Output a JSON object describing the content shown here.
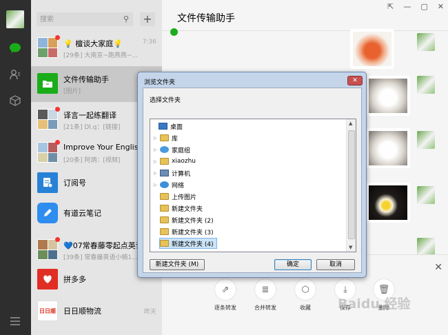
{
  "search": {
    "placeholder": "搜索"
  },
  "chats": [
    {
      "name": "💡 檀谈大家庭💡",
      "preview": "[29条] 大南京~跑燕燕~...",
      "time": "7:36"
    },
    {
      "name": "文件传输助手",
      "preview": "[图片]",
      "time": ""
    },
    {
      "name": "译言一起练翻译",
      "preview": "[21条] Dl.q：[链接]",
      "time": ""
    },
    {
      "name": "Improve Your English",
      "preview": "[20条] 阿炳：[视频]",
      "time": ""
    },
    {
      "name": "订阅号",
      "preview": "",
      "time": ""
    },
    {
      "name": "有道云笔记",
      "preview": "",
      "time": ""
    },
    {
      "name": "💙07常春藤零起点英语",
      "preview": "[39条] 常春藤英语小楠1...",
      "time": ""
    },
    {
      "name": "拼多多",
      "preview": "",
      "time": ""
    },
    {
      "name": "日日顺物流",
      "preview": "",
      "time": "昨天"
    }
  ],
  "main": {
    "title": "文件传输助手"
  },
  "window_controls": {
    "pin": "⇱",
    "min": "—",
    "max": "▢",
    "close": "✕"
  },
  "actions": [
    {
      "label": "逐条转发",
      "icon": "share-icon"
    },
    {
      "label": "合并转发",
      "icon": "merge-icon"
    },
    {
      "label": "收藏",
      "icon": "box-icon"
    },
    {
      "label": "保存",
      "icon": "download-icon"
    },
    {
      "label": "删除",
      "icon": "trash-icon"
    }
  ],
  "dialog": {
    "title": "浏览文件夹",
    "prompt": "选择文件夹",
    "tree": [
      {
        "label": "桌面",
        "level": 0,
        "expander": false
      },
      {
        "label": "库",
        "level": 1,
        "expander": true
      },
      {
        "label": "家庭组",
        "level": 1,
        "expander": true
      },
      {
        "label": "xiaozhu",
        "level": 1,
        "expander": true
      },
      {
        "label": "计算机",
        "level": 1,
        "expander": true
      },
      {
        "label": "网络",
        "level": 1,
        "expander": true
      },
      {
        "label": "上传图片",
        "level": 1,
        "expander": false
      },
      {
        "label": "新建文件夹",
        "level": 1,
        "expander": false
      },
      {
        "label": "新建文件夹 (2)",
        "level": 1,
        "expander": false
      },
      {
        "label": "新建文件夹 (3)",
        "level": 1,
        "expander": false
      },
      {
        "label": "新建文件夹 (4)",
        "level": 1,
        "expander": false,
        "selected": true
      }
    ],
    "new_folder": "新建文件夹 (M)",
    "ok": "确定",
    "cancel": "取消"
  },
  "watermark": "Baidu 经验"
}
